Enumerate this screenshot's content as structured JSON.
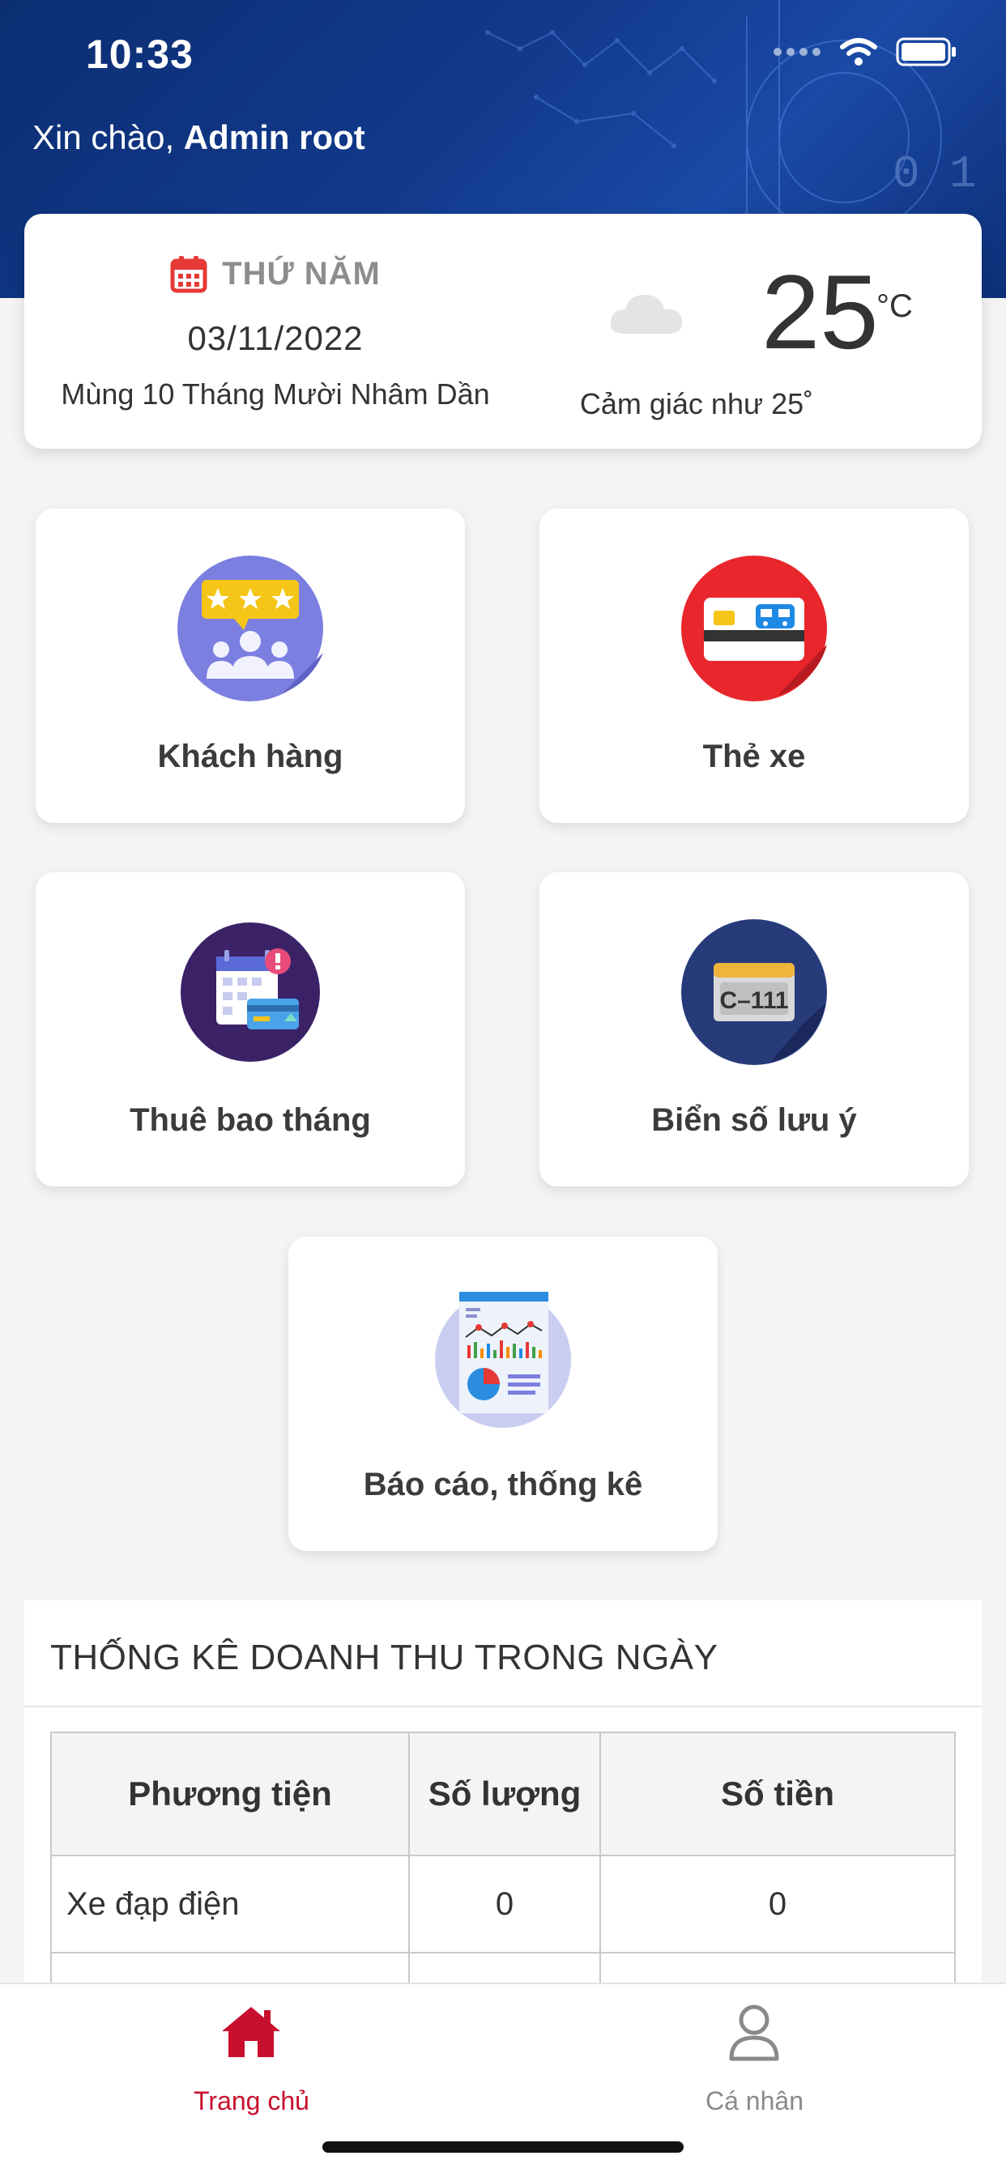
{
  "status_bar": {
    "time": "10:33"
  },
  "header": {
    "greeting_prefix": "Xin chào, ",
    "user_name": "Admin root"
  },
  "info_card": {
    "day_name": "THỨ NĂM",
    "date": "03/11/2022",
    "lunar_date": "Mùng 10 Tháng Mười Nhâm Dần",
    "temperature": "25",
    "temperature_unit": "°C",
    "feels_like": "Cảm giác như 25˚",
    "weather_icon": "cloud-icon"
  },
  "tiles": [
    {
      "label": "Khách hàng",
      "icon": "customers-rating-icon"
    },
    {
      "label": "Thẻ xe",
      "icon": "vehicle-card-icon"
    },
    {
      "label": "Thuê bao tháng",
      "icon": "monthly-subscription-icon"
    },
    {
      "label": "Biển số lưu ý",
      "icon": "license-plate-icon"
    },
    {
      "label": "Báo cáo, thống kê",
      "icon": "report-chart-icon"
    }
  ],
  "revenue": {
    "title": "THỐNG KÊ DOANH THU TRONG NGÀY",
    "columns": [
      "Phương tiện",
      "Số lượng",
      "Số tiền"
    ],
    "rows": [
      [
        "Xe đạp điện",
        "0",
        "0"
      ]
    ]
  },
  "tabbar": {
    "items": [
      {
        "label": "Trang chủ",
        "icon": "home-icon",
        "active": true
      },
      {
        "label": "Cá nhân",
        "icon": "user-icon",
        "active": false
      }
    ]
  },
  "colors": {
    "header_bg": "#123a8c",
    "accent_red": "#c8102e",
    "calendar_red": "#e53935",
    "tab_inactive": "#8a8a8a"
  }
}
